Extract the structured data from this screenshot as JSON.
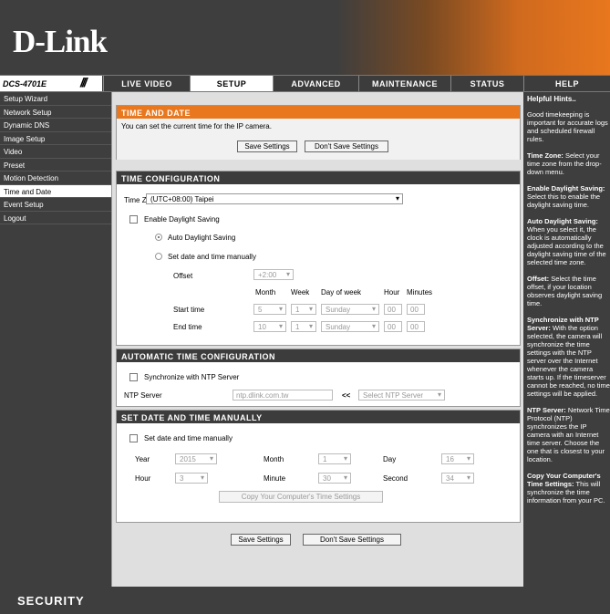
{
  "brand": {
    "logo": "D-Link",
    "model": "DCS-4701E",
    "footer": "SECURITY"
  },
  "nav": {
    "tabs": [
      "LIVE VIDEO",
      "SETUP",
      "ADVANCED",
      "MAINTENANCE",
      "STATUS",
      "HELP"
    ]
  },
  "sidebar": {
    "items": [
      {
        "label": "Setup Wizard"
      },
      {
        "label": "Network Setup"
      },
      {
        "label": "Dynamic DNS"
      },
      {
        "label": "Image Setup"
      },
      {
        "label": "Video"
      },
      {
        "label": "Preset"
      },
      {
        "label": "Motion Detection"
      },
      {
        "label": "Time and Date"
      },
      {
        "label": "Event Setup"
      },
      {
        "label": "Logout"
      }
    ]
  },
  "tad": {
    "title": "TIME AND DATE",
    "desc": "You can set the current time for the IP camera.",
    "save": "Save Settings",
    "dont_save": "Don't Save Settings"
  },
  "tc": {
    "title": "TIME CONFIGURATION",
    "tz_label": "Time Zone",
    "tz_value": "(UTC+08:00) Taipei",
    "dst_label": "Enable Daylight Saving",
    "auto_dst": "Auto Daylight Saving",
    "manual_dst": "Set date and time manually",
    "offset_label": "Offset",
    "offset_value": "+2:00",
    "h_month": "Month",
    "h_week": "Week",
    "h_dow": "Day of week",
    "h_hour": "Hour",
    "h_min": "Minutes",
    "start_label": "Start time",
    "end_label": "End time",
    "start": {
      "month": "5",
      "week": "1",
      "dow": "Sunday",
      "hour": "00",
      "min": "00"
    },
    "end": {
      "month": "10",
      "week": "1",
      "dow": "Sunday",
      "hour": "00",
      "min": "00"
    }
  },
  "atc": {
    "title": "AUTOMATIC TIME CONFIGURATION",
    "sync_label": "Synchronize with NTP Server",
    "ntp_label": "NTP Server",
    "ntp_value": "ntp.dlink.com.tw",
    "arrows": "<<",
    "ntp_select": "Select NTP Server"
  },
  "sdm": {
    "title": "SET DATE AND TIME MANUALLY",
    "check_label": "Set date and time manually",
    "year_label": "Year",
    "year": "2015",
    "month_label": "Month",
    "month": "1",
    "day_label": "Day",
    "day": "16",
    "hour_label": "Hour",
    "hour": "3",
    "minute_label": "Minute",
    "minute": "30",
    "second_label": "Second",
    "second": "34",
    "copy_btn": "Copy Your Computer's Time Settings"
  },
  "bottom": {
    "save": "Save Settings",
    "dont_save": "Don't Save Settings"
  },
  "hints": {
    "title": "Helpful Hints..",
    "intro": "Good timekeeping is important for accurate logs and scheduled firewall rules.",
    "tz_b": "Time Zone:",
    "tz_t": "Select your time zone from the drop-down menu.",
    "edst_b": "Enable Daylight Saving:",
    "edst_t": "Select this to enable the daylight saving time.",
    "adst_b": "Auto Daylight Saving:",
    "adst_t": "When you select it, the clock is automatically adjusted according to the daylight saving time of the selected time zone.",
    "off_b": "Offset:",
    "off_t": "Select the time offset, if your location observes daylight saving time.",
    "ntp_b": "Synchronize with NTP Server:",
    "ntp_t": "With the option selected, the camera will synchronize the time settings with the NTP server over the Internet whenever the camera starts up. If the timeserver cannot be reached, no time settings will be applied.",
    "ntps_b": "NTP Server:",
    "ntps_t": "Network Time Protocol (NTP) synchronizes the IP camera with an Internet time server. Choose the one that is closest to your location.",
    "copy_b": "Copy Your Computer's Time Settings:",
    "copy_t": "This will synchronize the time information from your PC."
  }
}
